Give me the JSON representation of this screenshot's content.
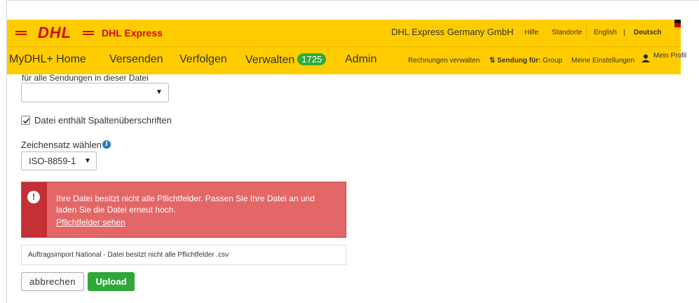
{
  "header": {
    "brand": "DHL Express",
    "company": "DHL Express Germany GmbH",
    "links": [
      "Hilfe",
      "Standorte",
      "English",
      "Deutsch"
    ],
    "logo_text": "DHL"
  },
  "nav": {
    "items": [
      "MyDHL+ Home",
      "Versenden",
      "Verfolgen",
      "Verwalten",
      "Admin"
    ],
    "verwalten_badge": "1725",
    "right": {
      "rechnungen": "Rechnungen verwalten",
      "sendung_label": "Sendung für:",
      "sendung_value": "Group",
      "einstellungen": "Meine Einstellungen",
      "profil": "Mein Profil"
    }
  },
  "form": {
    "top_label": "für alle Sendungen in dieser Datei",
    "select1_value": "",
    "checkbox_label": "Datei enthält Spaltenüberschriften",
    "checkbox_checked": true,
    "charset_label": "Zeichensatz wählen",
    "charset_value": "ISO-8859-1"
  },
  "alert": {
    "message": "Ihre Datei besitzt nicht alle Pflichtfelder. Passen Sie Ihre Datei an und laden Sie die Datei erneut hoch.",
    "link": "Pflichtfelder sehen"
  },
  "file": {
    "name": "Auftragsimport National - Datei besitzt nicht alle Pflichtfelder .csv"
  },
  "buttons": {
    "cancel": "abbrechen",
    "upload": "Upload"
  },
  "colors": {
    "dhl_yellow": "#ffcc00",
    "dhl_red": "#d40511",
    "alert_bg": "#e46767",
    "upload_green": "#2fa83a"
  }
}
